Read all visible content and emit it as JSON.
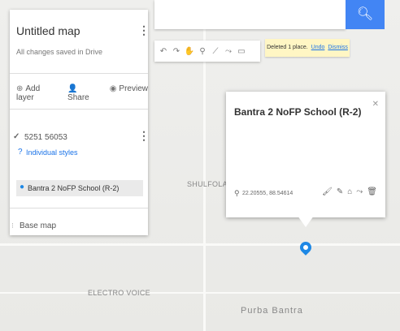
{
  "panel": {
    "title": "Untitled map",
    "saved_status": "All changes saved in Drive",
    "actions": [
      {
        "icon": "add-layer-icon",
        "glyph": "⊕",
        "label": "Add layer"
      },
      {
        "icon": "share-icon",
        "glyph": "👤",
        "label": "Share"
      },
      {
        "icon": "preview-icon",
        "glyph": "◉",
        "label": "Preview"
      }
    ],
    "layer_name": "5251 56053",
    "layer_styles": "Individual styles",
    "feature": "Bantra 2 NoFP School (R-2)",
    "base_map": "Base map"
  },
  "toolbar": {
    "tools": [
      {
        "icon": "undo-icon",
        "glyph": "↶"
      },
      {
        "icon": "redo-icon",
        "glyph": "↷"
      },
      {
        "icon": "hand-icon",
        "glyph": "✋"
      },
      {
        "icon": "marker-icon",
        "glyph": "⚲"
      },
      {
        "icon": "line-icon",
        "glyph": "⟋"
      },
      {
        "icon": "directions-icon",
        "glyph": "⤳"
      },
      {
        "icon": "ruler-icon",
        "glyph": "▭"
      }
    ]
  },
  "toast": {
    "message": "Deleted 1 place.",
    "undo": "Undo",
    "dismiss": "Dismiss"
  },
  "card": {
    "title": "Bantra 2 NoFP School (R-2)",
    "coords": "22.20555, 88.54614",
    "tools": [
      {
        "icon": "style-icon",
        "glyph": "🖌"
      },
      {
        "icon": "edit-icon",
        "glyph": "✎"
      },
      {
        "icon": "camera-icon",
        "glyph": "⌂"
      },
      {
        "icon": "directions-icon",
        "glyph": "⤳"
      },
      {
        "icon": "delete-icon",
        "glyph": "🗑"
      }
    ]
  },
  "map_labels": {
    "shulfola": "SHULFOLA",
    "electro": "ELECTRO VOICE",
    "purba": "Purba Bantra"
  },
  "colors": {
    "accent": "#4285f4",
    "pin": "#1e88e5",
    "toast_bg": "#fff6c4"
  }
}
